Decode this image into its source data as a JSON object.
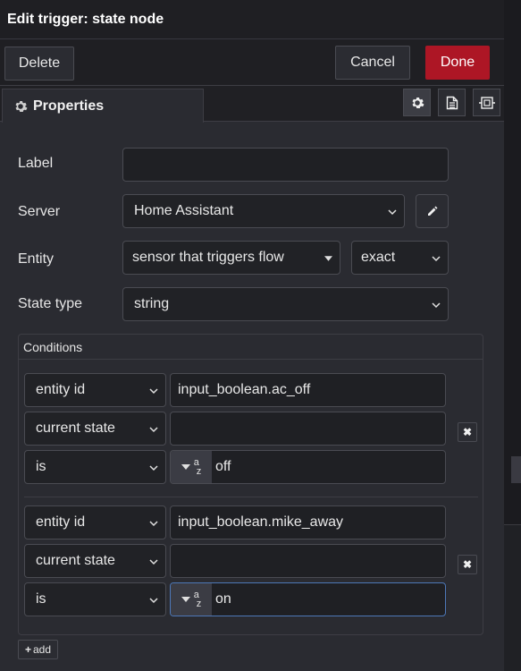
{
  "dialog": {
    "title": "Edit trigger: state node"
  },
  "toolbar": {
    "delete_label": "Delete",
    "cancel_label": "Cancel",
    "done_label": "Done"
  },
  "tabs": {
    "properties_label": "Properties"
  },
  "form": {
    "label": {
      "label": "Label",
      "value": ""
    },
    "server": {
      "label": "Server",
      "value": "Home Assistant"
    },
    "entity": {
      "label": "Entity",
      "value": "sensor that triggers flow",
      "match": "exact"
    },
    "state_type": {
      "label": "State type",
      "value": "string"
    }
  },
  "conditions": {
    "header": "Conditions",
    "items": [
      {
        "type": "entity id",
        "entity": "input_boolean.ac_off",
        "property": "current state",
        "property_value": "",
        "operator": "is",
        "value_type_icon": "a-z",
        "value": "off"
      },
      {
        "type": "entity id",
        "entity": "input_boolean.mike_away",
        "property": "current state",
        "property_value": "",
        "operator": "is",
        "value_type_icon": "a-z",
        "value": "on"
      }
    ],
    "add_label": "add"
  },
  "colors": {
    "accent_done": "#ad1625",
    "background": "#2a2b31",
    "focus_border": "#4d78b8"
  }
}
